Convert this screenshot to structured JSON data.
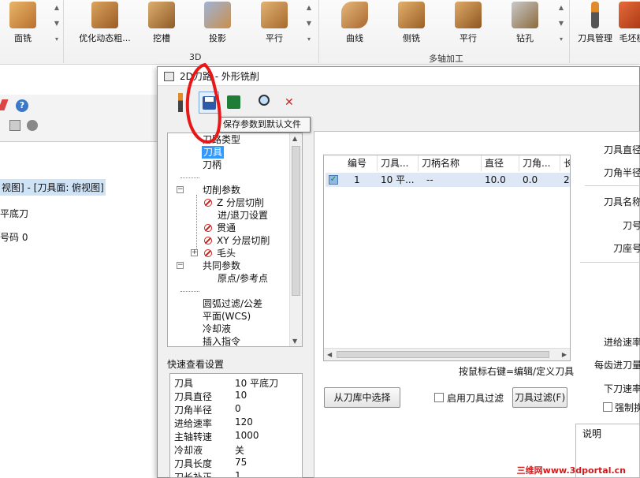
{
  "ribbon": {
    "buttons": [
      {
        "label": "面铣",
        "icon": "face-mill-icon"
      },
      {
        "label": "优化动态粗...",
        "icon": "dynamic-rough-icon"
      },
      {
        "label": "挖槽",
        "icon": "pocket-icon"
      },
      {
        "label": "投影",
        "icon": "project-icon"
      },
      {
        "label": "平行",
        "icon": "parallel-icon"
      },
      {
        "label": "曲线",
        "icon": "curve-icon"
      },
      {
        "label": "侧铣",
        "icon": "swarf-icon"
      },
      {
        "label": "平行",
        "icon": "parallel-multiaxis-icon"
      },
      {
        "label": "钻孔",
        "icon": "drill-icon"
      },
      {
        "label": "刀具管理",
        "icon": "tool-manager-icon"
      },
      {
        "label": "毛坯模",
        "icon": "stock-model-icon"
      }
    ],
    "groups": {
      "g3d": "3D",
      "multiaxis": "多轴加工"
    }
  },
  "background": {
    "line1": "视图] - [刀具面: 俯视图]",
    "line2": "平底刀",
    "line3": "号码 0"
  },
  "dialog": {
    "title": "2D刀路 - 外形铣削",
    "tooltip": "保存参数到默认文件",
    "tree": {
      "items": [
        "刀路类型",
        "刀具",
        "刀柄",
        "切削参数",
        "Z 分层切削",
        "进/退刀设置",
        "贯通",
        "XY 分层切削",
        "毛头",
        "共同参数",
        "原点/参考点",
        "圆弧过滤/公差",
        "平面(WCS)",
        "冷却液",
        "插入指令"
      ]
    },
    "quickview": {
      "title": "快速查看设置",
      "rows": [
        {
          "k": "刀具",
          "v": "10 平底刀"
        },
        {
          "k": "刀具直径",
          "v": "10"
        },
        {
          "k": "刀角半径",
          "v": "0"
        },
        {
          "k": "进给速率",
          "v": "120"
        },
        {
          "k": "主轴转速",
          "v": "1000"
        },
        {
          "k": "冷却液",
          "v": "关"
        },
        {
          "k": "刀具长度",
          "v": "75"
        },
        {
          "k": "刀长补正",
          "v": "1"
        }
      ]
    },
    "table": {
      "headers": [
        "编号",
        "刀具...",
        "刀柄名称",
        "直径",
        "刀角...",
        "长"
      ],
      "row": [
        "1",
        "10 平...",
        "--",
        "10.0",
        "0.0",
        "2"
      ]
    },
    "hint": "按鼠标右键=编辑/定义刀具",
    "buttons": {
      "select_from_lib": "从刀库中选择",
      "enable_filter": "启用刀具过滤",
      "filter": "刀具过滤(F)"
    },
    "right_labels": {
      "diameter": "刀具直径",
      "corner_radius": "刀角半径",
      "tool_name": "刀具名称",
      "tool_number": "刀号",
      "seat_number": "刀座号",
      "feed_rate": "进给速率",
      "feed_per_tooth": "每齿进刀量",
      "plunge_rate": "下刀速率",
      "force": "强制换",
      "description": "说明"
    }
  },
  "watermark": "三维网www.3dportal.cn"
}
